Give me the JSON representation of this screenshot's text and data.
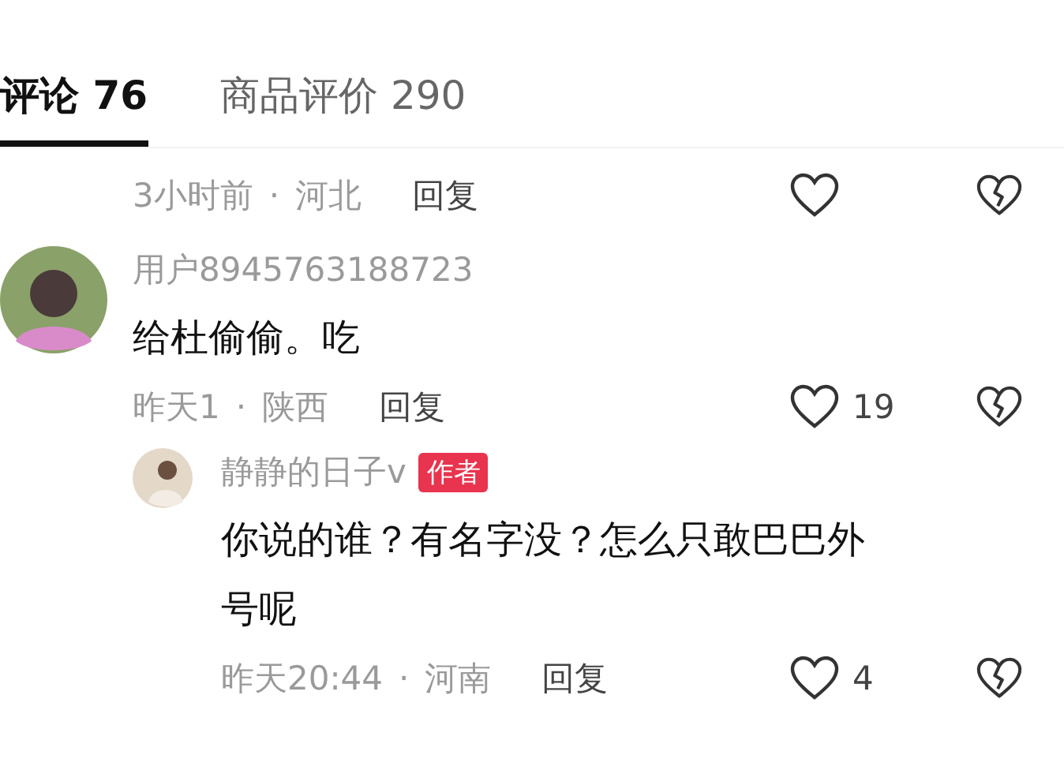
{
  "tabs": [
    {
      "label": "评论 76",
      "selected": true
    },
    {
      "label": "商品评价 290",
      "selected": false
    }
  ],
  "comments": [
    {
      "kind": "partial",
      "meta": {
        "time": "3小时前",
        "separator": "·",
        "location": "河北",
        "reply": "回复"
      }
    },
    {
      "kind": "comment",
      "user": "用户8945763188723",
      "text": "给杜偷偷。吃",
      "meta": {
        "time": "昨天1",
        "separator": "·",
        "location": "陕西",
        "reply": "回复",
        "likes": "19"
      }
    },
    {
      "kind": "reply",
      "user": "静静的日子v",
      "badge": "作者",
      "text": "你说的谁？有名字没？怎么只敢巴巴外号呢",
      "meta": {
        "time": "昨天20:44",
        "separator": "·",
        "location": "河南",
        "reply": "回复",
        "likes": "4"
      }
    }
  ]
}
